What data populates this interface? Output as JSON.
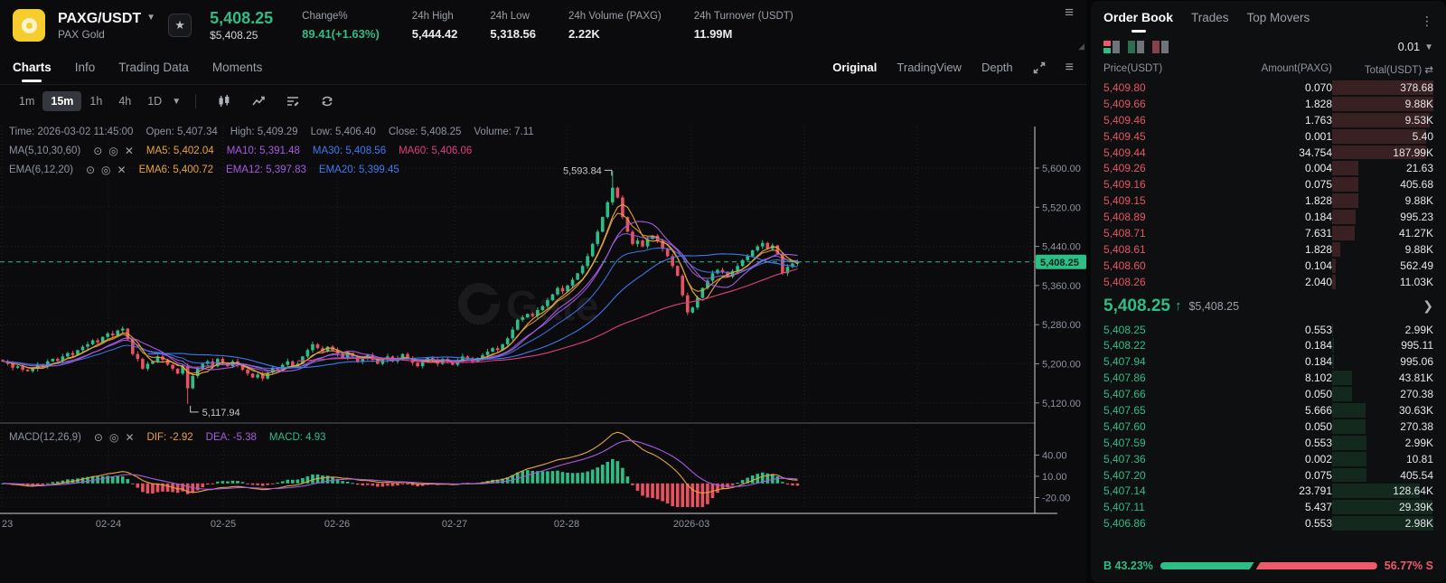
{
  "header": {
    "pair": "PAXG/USDT",
    "pair_name": "PAX Gold",
    "last_price": "5,408.25",
    "last_price_fiat": "$5,408.25",
    "stats": [
      {
        "label": "Change%",
        "value": "89.41(+1.63%)",
        "accent": "up"
      },
      {
        "label": "24h High",
        "value": "5,444.42"
      },
      {
        "label": "24h Low",
        "value": "5,318.56"
      },
      {
        "label": "24h Volume (PAXG)",
        "value": "2.22K"
      },
      {
        "label": "24h Turnover (USDT)",
        "value": "11.99M"
      }
    ]
  },
  "tabs": {
    "left": [
      "Charts",
      "Info",
      "Trading Data",
      "Moments"
    ],
    "active_left": "Charts",
    "right": [
      "Original",
      "TradingView",
      "Depth"
    ],
    "active_right": "Original"
  },
  "toolbar": {
    "timeframes": [
      "1m",
      "15m",
      "1h",
      "4h",
      "1D"
    ],
    "active": "15m"
  },
  "ohlc": {
    "items": [
      {
        "label": "Time",
        "value": "2026-03-02 11:45:00"
      },
      {
        "label": "Open",
        "value": "5,407.34"
      },
      {
        "label": "High",
        "value": "5,409.29"
      },
      {
        "label": "Low",
        "value": "5,406.40"
      },
      {
        "label": "Close",
        "value": "5,408.25"
      },
      {
        "label": "Volume",
        "value": "7.11"
      }
    ]
  },
  "indicators": {
    "ma": {
      "name": "MA(5,10,30,60)",
      "values": [
        {
          "label": "MA5",
          "value": "5,402.04",
          "color": "#e8a33d"
        },
        {
          "label": "MA10",
          "value": "5,391.48",
          "color": "#a35ce0"
        },
        {
          "label": "MA30",
          "value": "5,408.56",
          "color": "#3d7bf0"
        },
        {
          "label": "MA60",
          "value": "5,406.06",
          "color": "#e03d7e"
        }
      ]
    },
    "ema": {
      "name": "EMA(6,12,20)",
      "values": [
        {
          "label": "EMA6",
          "value": "5,400.72",
          "color": "#e8a33d"
        },
        {
          "label": "EMA12",
          "value": "5,397.83",
          "color": "#a35ce0"
        },
        {
          "label": "EMA20",
          "value": "5,399.45",
          "color": "#3d7bf0"
        }
      ]
    },
    "macd": {
      "name": "MACD(12,26,9)",
      "values": [
        {
          "label": "DIF",
          "value": "-2.92",
          "color": "#e8a33d"
        },
        {
          "label": "DEA",
          "value": "-5.38",
          "color": "#a35ce0"
        },
        {
          "label": "MACD",
          "value": "4.93",
          "color": "#2ebd85"
        }
      ]
    }
  },
  "chart_data": {
    "type": "candlestick",
    "interval": "15m",
    "title": "PAXG/USDT 15m candlestick with MA/EMA overlays and MACD(12,26,9)",
    "x_axis_labels": [
      "23",
      "02-24",
      "02-25",
      "02-26",
      "02-27",
      "02-28",
      "2026-03"
    ],
    "y_ticks": [
      "5,600.00",
      "5,520.00",
      "5,440.00",
      "5,360.00",
      "5,280.00",
      "5,200.00",
      "5,120.00"
    ],
    "y_tick_values": [
      5600,
      5520,
      5440,
      5360,
      5280,
      5200,
      5120
    ],
    "macd_ticks": [
      "40.00",
      "10.00",
      "-20.00"
    ],
    "macd_tick_values": [
      40,
      10,
      -20
    ],
    "current_price": 5408.25,
    "current_price_label": "5,408.25",
    "annotation_high": {
      "value": 5593.84,
      "label": "5,593.84",
      "index": 122
    },
    "annotation_low": {
      "value": 5117.94,
      "label": "5,117.94",
      "index": 37
    },
    "watermark": "Gate",
    "colors": {
      "up": "#2ebd85",
      "down": "#e8515f",
      "orange": "#e8a33d",
      "purple": "#a35ce0",
      "blue": "#3d7bf0",
      "pink": "#e03d7e"
    },
    "closes": [
      5205,
      5200,
      5192,
      5195,
      5188,
      5185,
      5190,
      5198,
      5194,
      5205,
      5210,
      5206,
      5215,
      5222,
      5218,
      5228,
      5235,
      5240,
      5248,
      5244,
      5255,
      5262,
      5258,
      5268,
      5272,
      5250,
      5220,
      5210,
      5190,
      5200,
      5205,
      5215,
      5208,
      5198,
      5190,
      5180,
      5195,
      5150,
      5175,
      5190,
      5200,
      5205,
      5195,
      5210,
      5202,
      5195,
      5205,
      5198,
      5188,
      5180,
      5172,
      5178,
      5170,
      5182,
      5192,
      5188,
      5198,
      5205,
      5195,
      5200,
      5215,
      5228,
      5240,
      5232,
      5225,
      5235,
      5228,
      5220,
      5212,
      5222,
      5215,
      5205,
      5210,
      5218,
      5208,
      5200,
      5208,
      5215,
      5205,
      5212,
      5220,
      5210,
      5202,
      5195,
      5205,
      5212,
      5208,
      5200,
      5210,
      5205,
      5198,
      5208,
      5215,
      5210,
      5205,
      5212,
      5218,
      5225,
      5232,
      5228,
      5240,
      5252,
      5270,
      5290,
      5295,
      5302,
      5298,
      5310,
      5318,
      5330,
      5342,
      5355,
      5348,
      5360,
      5372,
      5385,
      5400,
      5420,
      5445,
      5470,
      5500,
      5530,
      5560,
      5540,
      5500,
      5470,
      5445,
      5452,
      5440,
      5455,
      5462,
      5450,
      5435,
      5420,
      5400,
      5380,
      5340,
      5305,
      5315,
      5335,
      5355,
      5370,
      5385,
      5392,
      5388,
      5378,
      5390,
      5400,
      5412,
      5420,
      5432,
      5440,
      5447,
      5435,
      5442,
      5425,
      5385,
      5398,
      5405,
      5408.25
    ]
  },
  "order_book": {
    "tabs": [
      "Order Book",
      "Trades",
      "Top Movers"
    ],
    "active_tab": "Order Book",
    "precision": "0.01",
    "columns": [
      "Price(USDT)",
      "Amount(PAXG)",
      "Total(USDT)"
    ],
    "asks": [
      {
        "price": "5,409.80",
        "amount": "0.070",
        "total": "378.68",
        "depth": 100
      },
      {
        "price": "5,409.66",
        "amount": "1.828",
        "total": "9.88K",
        "depth": 100
      },
      {
        "price": "5,409.46",
        "amount": "1.763",
        "total": "9.53K",
        "depth": 96
      },
      {
        "price": "5,409.45",
        "amount": "0.001",
        "total": "5.40",
        "depth": 93
      },
      {
        "price": "5,409.44",
        "amount": "34.754",
        "total": "187.99K",
        "depth": 93
      },
      {
        "price": "5,409.26",
        "amount": "0.004",
        "total": "21.63",
        "depth": 26
      },
      {
        "price": "5,409.16",
        "amount": "0.075",
        "total": "405.68",
        "depth": 26
      },
      {
        "price": "5,409.15",
        "amount": "1.828",
        "total": "9.88K",
        "depth": 26
      },
      {
        "price": "5,408.89",
        "amount": "0.184",
        "total": "995.23",
        "depth": 23
      },
      {
        "price": "5,408.71",
        "amount": "7.631",
        "total": "41.27K",
        "depth": 22
      },
      {
        "price": "5,408.61",
        "amount": "1.828",
        "total": "9.88K",
        "depth": 8
      },
      {
        "price": "5,408.60",
        "amount": "0.104",
        "total": "562.49",
        "depth": 4
      },
      {
        "price": "5,408.26",
        "amount": "2.040",
        "total": "11.03K",
        "depth": 4
      }
    ],
    "mid": {
      "price": "5,408.25",
      "direction": "up",
      "fiat": "$5,408.25"
    },
    "bids": [
      {
        "price": "5,408.25",
        "amount": "0.553",
        "total": "2.99K",
        "depth": 1
      },
      {
        "price": "5,408.22",
        "amount": "0.184",
        "total": "995.11",
        "depth": 2
      },
      {
        "price": "5,407.94",
        "amount": "0.184",
        "total": "995.06",
        "depth": 2
      },
      {
        "price": "5,407.86",
        "amount": "8.102",
        "total": "43.81K",
        "depth": 20
      },
      {
        "price": "5,407.66",
        "amount": "0.050",
        "total": "270.38",
        "depth": 20
      },
      {
        "price": "5,407.65",
        "amount": "5.666",
        "total": "30.63K",
        "depth": 33
      },
      {
        "price": "5,407.60",
        "amount": "0.050",
        "total": "270.38",
        "depth": 33
      },
      {
        "price": "5,407.59",
        "amount": "0.553",
        "total": "2.99K",
        "depth": 34
      },
      {
        "price": "5,407.36",
        "amount": "0.002",
        "total": "10.81",
        "depth": 34
      },
      {
        "price": "5,407.20",
        "amount": "0.075",
        "total": "405.54",
        "depth": 34
      },
      {
        "price": "5,407.14",
        "amount": "23.791",
        "total": "128.64K",
        "depth": 87
      },
      {
        "price": "5,407.11",
        "amount": "5.437",
        "total": "29.39K",
        "depth": 99
      },
      {
        "price": "5,406.86",
        "amount": "0.553",
        "total": "2.98K",
        "depth": 100
      }
    ],
    "buy_label": "B",
    "sell_label": "S",
    "buy_ratio": "43.23%",
    "sell_ratio": "56.77%",
    "buy_pct": 43.23
  }
}
